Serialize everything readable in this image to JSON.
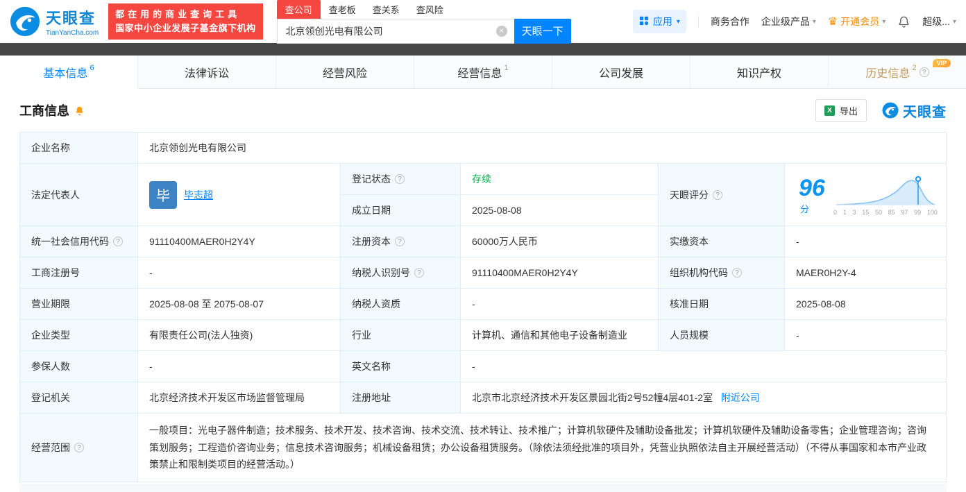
{
  "header": {
    "logo": {
      "name": "天眼查",
      "domain": "TianYanCha.com"
    },
    "slogan_line1": "都在用的商业查询工具",
    "slogan_line2": "国家中小企业发展子基金旗下机构",
    "search_tabs": [
      {
        "label": "查公司"
      },
      {
        "label": "查老板"
      },
      {
        "label": "查关系"
      },
      {
        "label": "查风险"
      }
    ],
    "search_value": "北京领创光电有限公司",
    "search_button": "天眼一下",
    "menu": {
      "apps": "应用",
      "cooperation": "商务合作",
      "enterprise": "企业级产品",
      "vip": "开通会员",
      "super": "超级..."
    }
  },
  "tabs": [
    {
      "label": "基本信息",
      "count": "6"
    },
    {
      "label": "法律诉讼"
    },
    {
      "label": "经营风险"
    },
    {
      "label": "经营信息",
      "count": "1"
    },
    {
      "label": "公司发展"
    },
    {
      "label": "知识产权"
    },
    {
      "label": "历史信息",
      "count": "2",
      "badge": "VIP"
    }
  ],
  "section": {
    "title": "工商信息",
    "export_label": "导出",
    "brand": "天眼查"
  },
  "info": {
    "company_name": {
      "label": "企业名称",
      "value": "北京领创光电有限公司"
    },
    "legal_rep": {
      "label": "法定代表人",
      "avatar": "毕",
      "value": "毕志超"
    },
    "reg_status": {
      "label": "登记状态",
      "value": "存续"
    },
    "establish_date": {
      "label": "成立日期",
      "value": "2025-08-08"
    },
    "score": {
      "label": "天眼评分",
      "value": "96",
      "unit": "分",
      "ticks": [
        "0",
        "1",
        "3",
        "15",
        "50",
        "85",
        "97",
        "99",
        "100"
      ]
    },
    "credit_code": {
      "label": "统一社会信用代码",
      "value": "91110400MAER0H2Y4Y"
    },
    "reg_capital": {
      "label": "注册资本",
      "value": "60000万人民币"
    },
    "paid_capital": {
      "label": "实缴资本",
      "value": "-"
    },
    "reg_no": {
      "label": "工商注册号",
      "value": "-"
    },
    "taxpayer_no": {
      "label": "纳税人识别号",
      "value": "91110400MAER0H2Y4Y"
    },
    "org_code": {
      "label": "组织机构代码",
      "value": "MAER0H2Y-4"
    },
    "business_term": {
      "label": "营业期限",
      "value": "2025-08-08 至 2075-08-07"
    },
    "taxpayer_quality": {
      "label": "纳税人资质",
      "value": "-"
    },
    "approved_date": {
      "label": "核准日期",
      "value": "2025-08-08"
    },
    "company_type": {
      "label": "企业类型",
      "value": "有限责任公司(法人独资)"
    },
    "industry": {
      "label": "行业",
      "value": "计算机、通信和其他电子设备制造业"
    },
    "staff_size": {
      "label": "人员规模",
      "value": "-"
    },
    "insured_num": {
      "label": "参保人数",
      "value": "-"
    },
    "english_name": {
      "label": "英文名称",
      "value": "-"
    },
    "reg_authority": {
      "label": "登记机关",
      "value": "北京经济技术开发区市场监督管理局"
    },
    "reg_address": {
      "label": "注册地址",
      "value": "北京市北京经济技术开发区景园北街2号52幢4层401-2室",
      "link": "附近公司"
    },
    "business_scope": {
      "label": "经营范围",
      "value": "一般项目：光电子器件制造；技术服务、技术开发、技术咨询、技术交流、技术转让、技术推广；计算机软硬件及辅助设备批发；计算机软硬件及辅助设备零售；企业管理咨询；咨询策划服务；工程造价咨询业务；信息技术咨询服务；机械设备租赁；办公设备租赁服务。（除依法须经批准的项目外，凭营业执照依法自主开展经营活动）（不得从事国家和本市产业政策禁止和限制类项目的经营活动。）"
    }
  }
}
